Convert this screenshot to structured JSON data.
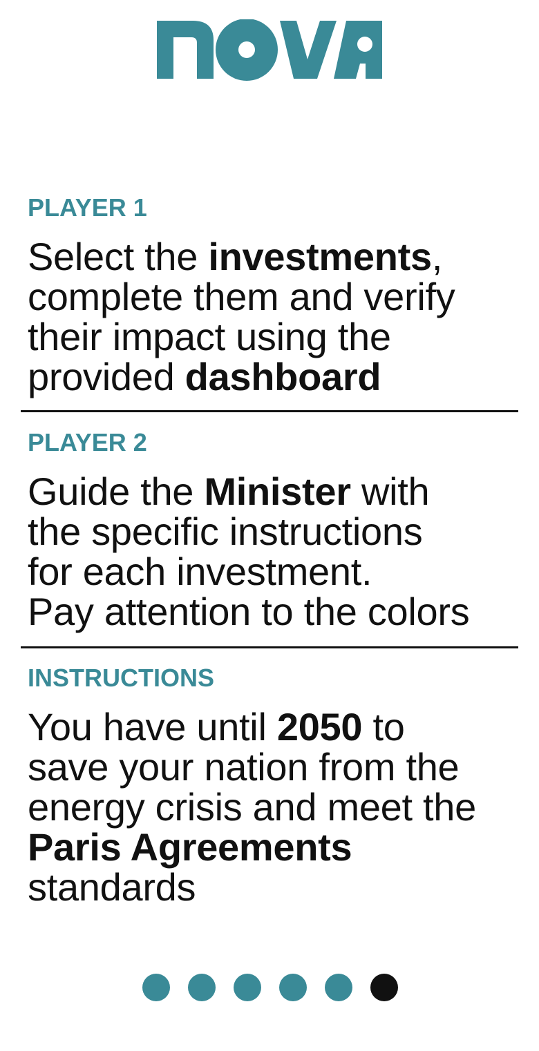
{
  "logo": {
    "text": "nova",
    "color": "#3a8a97"
  },
  "sections": [
    {
      "label": "PLAYER 1",
      "lines": [
        {
          "pre": "Select the ",
          "bold": "investments",
          "post": ","
        },
        {
          "pre": "complete them and verify",
          "bold": "",
          "post": ""
        },
        {
          "pre": "their impact using the",
          "bold": "",
          "post": ""
        },
        {
          "pre": "provided ",
          "bold": "dashboard",
          "post": ""
        }
      ]
    },
    {
      "label": "PLAYER 2",
      "lines": [
        {
          "pre": "Guide the ",
          "bold": "Minister",
          "post": " with"
        },
        {
          "pre": "the specific instructions",
          "bold": "",
          "post": ""
        },
        {
          "pre": "for each investment.",
          "bold": "",
          "post": ""
        },
        {
          "pre": "Pay attention to the colors",
          "bold": "",
          "post": ""
        }
      ]
    },
    {
      "label": "INSTRUCTIONS",
      "lines": [
        {
          "pre": "You have until ",
          "bold": "2050",
          "post": " to"
        },
        {
          "pre": "save your nation from the",
          "bold": "",
          "post": ""
        },
        {
          "pre": "energy crisis and meet the",
          "bold": "",
          "post": ""
        },
        {
          "pre": "",
          "bold": "Paris Agreements",
          "post": ""
        },
        {
          "pre": "standards",
          "bold": "",
          "post": ""
        }
      ]
    }
  ],
  "pagination": {
    "total": 6,
    "active_index": 5,
    "color": "#3a8a97",
    "active_color": "#111111"
  }
}
